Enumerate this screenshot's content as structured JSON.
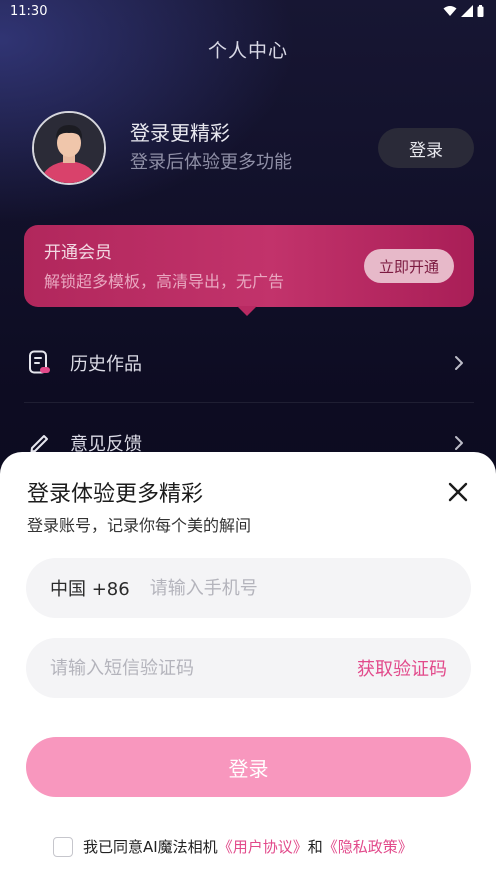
{
  "status_bar": {
    "time": "11:30"
  },
  "header": {
    "title": "个人中心"
  },
  "profile": {
    "title": "登录更精彩",
    "subtitle": "登录后体验更多功能",
    "login_button": "登录"
  },
  "vip": {
    "title": "开通会员",
    "subtitle": "解锁超多模板，高清导出，无广告",
    "button": "立即开通"
  },
  "menu": {
    "items": [
      {
        "label": "历史作品",
        "icon": "history-icon"
      },
      {
        "label": "意见反馈",
        "icon": "feedback-icon"
      }
    ]
  },
  "login_sheet": {
    "title": "登录体验更多精彩",
    "subtitle": "登录账号，记录你每个美的解间",
    "country_code": "中国 +86",
    "phone_placeholder": "请输入手机号",
    "code_placeholder": "请输入短信验证码",
    "get_code": "获取验证码",
    "login_button": "登录",
    "agree_prefix": "我已同意AI魔法相机",
    "user_agreement": "《用户协议》",
    "and": "和",
    "privacy_policy": "《隐私政策》"
  },
  "colors": {
    "accent": "#e24a8b",
    "login_button_bg": "#f897be",
    "vip_card": "#b92a62"
  }
}
